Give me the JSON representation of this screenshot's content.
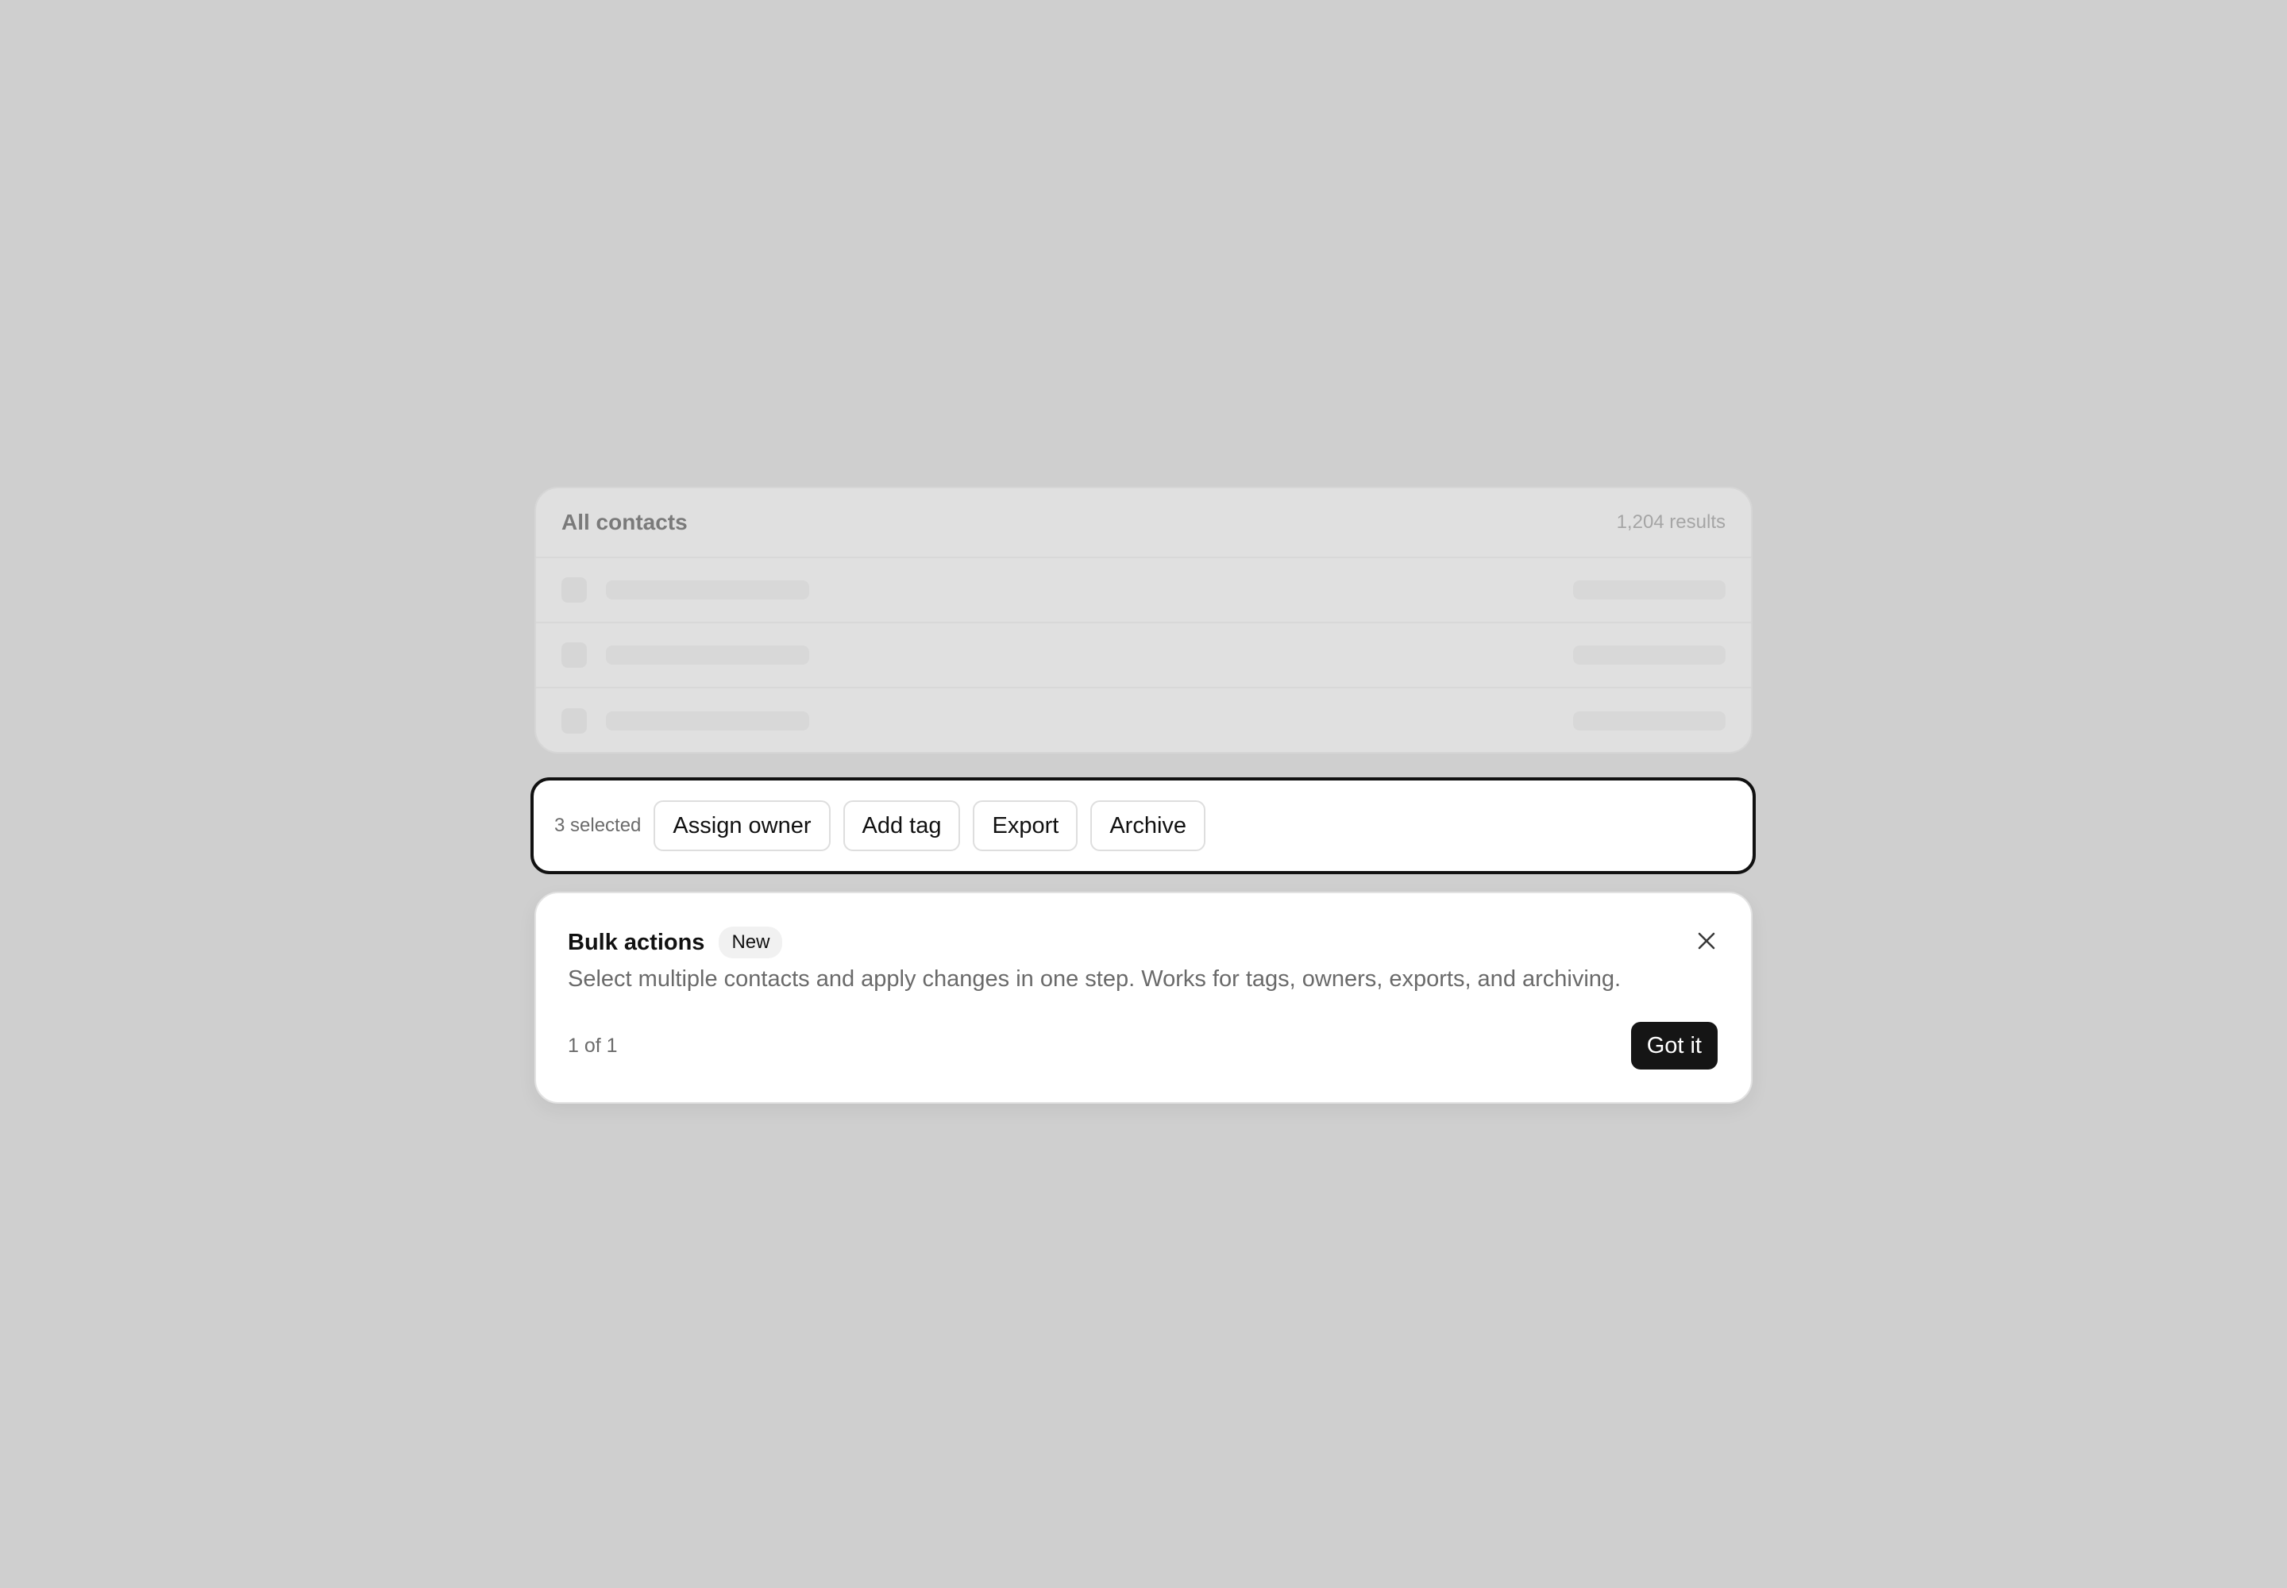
{
  "contacts": {
    "title": "All contacts",
    "result_count": "1,204 results",
    "rows": [
      {
        "placeholder": true
      },
      {
        "placeholder": true
      },
      {
        "placeholder": true
      }
    ]
  },
  "action_bar": {
    "selected_text": "3 selected",
    "actions": [
      {
        "label": "Assign owner"
      },
      {
        "label": "Add tag"
      },
      {
        "label": "Export"
      },
      {
        "label": "Archive"
      }
    ]
  },
  "tip": {
    "title": "Bulk actions",
    "badge": "New",
    "body": "Select multiple contacts and apply changes in one step. Works for tags, owners, exports, and archiving.",
    "step": "1 of 1",
    "primary_label": "Got it",
    "close_icon": "close-icon"
  },
  "colors": {
    "backdrop": "#cfcfcf",
    "highlight_border": "#111111",
    "primary_button": "#151515"
  }
}
